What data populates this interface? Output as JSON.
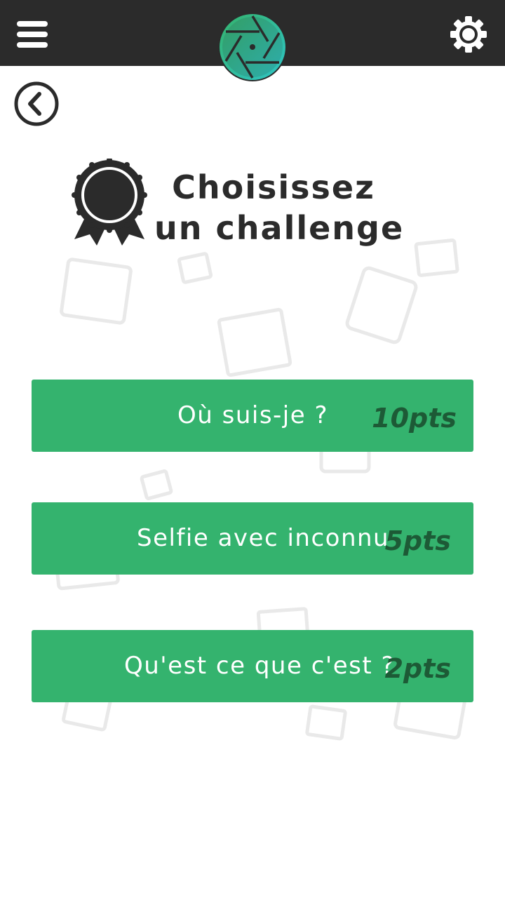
{
  "header": {
    "menu_icon": "hamburger-menu-icon",
    "logo_icon": "camera-shutter-logo",
    "settings_icon": "gear-icon",
    "colors": {
      "bar": "#2b2b2b",
      "logo_gradient": [
        "#34b36e",
        "#2ec4c4"
      ]
    }
  },
  "back_icon": "chevron-left-circle-icon",
  "page": {
    "badge_icon": "award-ribbon-icon",
    "title_line1": "Choisissez",
    "title_line2": "un challenge"
  },
  "challenges": [
    {
      "label": "Où suis-je ?",
      "points": "10pts"
    },
    {
      "label": "Selfie avec inconnu",
      "points": "5pts"
    },
    {
      "label": "Qu'est ce que c'est ?",
      "points": "2pts"
    }
  ],
  "colors": {
    "accent": "#34b36e",
    "points_text": "#1d5a36",
    "text_dark": "#2b2b2b"
  }
}
